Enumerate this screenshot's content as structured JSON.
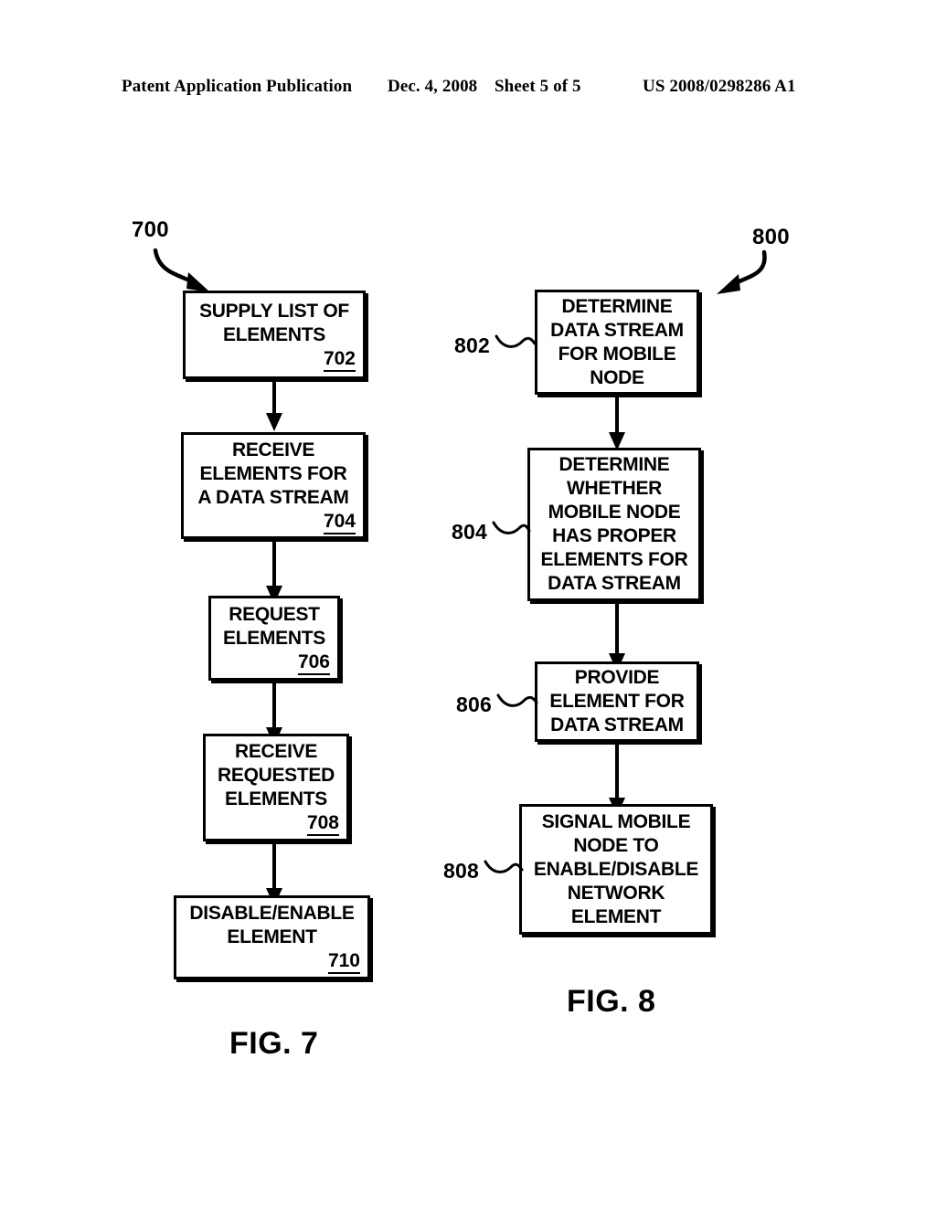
{
  "header": {
    "publication": "Patent Application Publication",
    "date": "Dec. 4, 2008",
    "sheet": "Sheet 5 of 5",
    "document_id": "US 2008/0298286 A1"
  },
  "figures": [
    {
      "caption": "FIG. 7",
      "reference": "700",
      "steps": [
        {
          "ref": "702",
          "lines": [
            "SUPPLY LIST OF",
            "ELEMENTS"
          ]
        },
        {
          "ref": "704",
          "lines": [
            "RECEIVE",
            "ELEMENTS FOR",
            "A DATA STREAM"
          ]
        },
        {
          "ref": "706",
          "lines": [
            "REQUEST",
            "ELEMENTS"
          ]
        },
        {
          "ref": "708",
          "lines": [
            "RECEIVE",
            "REQUESTED",
            "ELEMENTS"
          ]
        },
        {
          "ref": "710",
          "lines": [
            "DISABLE/ENABLE",
            "ELEMENT"
          ]
        }
      ]
    },
    {
      "caption": "FIG. 8",
      "reference": "800",
      "steps": [
        {
          "ref": "802",
          "lines": [
            "DETERMINE",
            "DATA STREAM",
            "FOR MOBILE",
            "NODE"
          ]
        },
        {
          "ref": "804",
          "lines": [
            "DETERMINE",
            "WHETHER",
            "MOBILE NODE",
            "HAS PROPER",
            "ELEMENTS FOR",
            "DATA STREAM"
          ]
        },
        {
          "ref": "806",
          "lines": [
            "PROVIDE",
            "ELEMENT FOR",
            "DATA STREAM"
          ]
        },
        {
          "ref": "808",
          "lines": [
            "SIGNAL MOBILE",
            "NODE TO",
            "ENABLE/DISABLE",
            "NETWORK",
            "ELEMENT"
          ]
        }
      ]
    }
  ]
}
